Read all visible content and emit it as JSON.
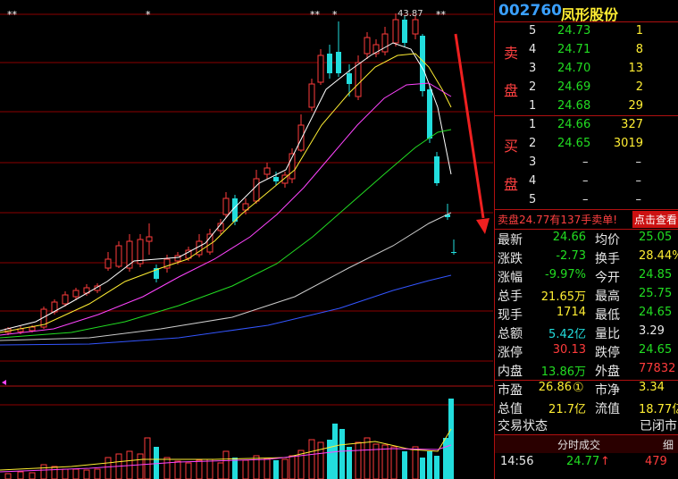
{
  "stock": {
    "code": "002760",
    "name": "凤形股份"
  },
  "marks": {
    "top_value": "43.87"
  },
  "sell_side": [
    "卖",
    "盘"
  ],
  "buy_side": [
    "买",
    "盘"
  ],
  "sell_orders": [
    {
      "level": "5",
      "price": "24.73",
      "volume": "1"
    },
    {
      "level": "4",
      "price": "24.71",
      "volume": "8"
    },
    {
      "level": "3",
      "price": "24.70",
      "volume": "13"
    },
    {
      "level": "2",
      "price": "24.69",
      "volume": "2"
    },
    {
      "level": "1",
      "price": "24.68",
      "volume": "29"
    }
  ],
  "buy_orders": [
    {
      "level": "1",
      "price": "24.66",
      "volume": "327"
    },
    {
      "level": "2",
      "price": "24.65",
      "volume": "3019"
    },
    {
      "level": "3",
      "price": "–",
      "volume": "–"
    },
    {
      "level": "4",
      "price": "–",
      "volume": "–"
    },
    {
      "level": "5",
      "price": "–",
      "volume": "–"
    }
  ],
  "notice": {
    "text": "卖盘24.77有137手卖单!",
    "action": "点击查看"
  },
  "stats": [
    {
      "l1": "最新",
      "v1": "24.66",
      "c1": "green",
      "l2": "均价",
      "v2": "25.05",
      "c2": "green"
    },
    {
      "l1": "涨跌",
      "v1": "-2.73",
      "c1": "green",
      "l2": "换手",
      "v2": "28.44%",
      "c2": "yellow"
    },
    {
      "l1": "涨幅",
      "v1": "-9.97%",
      "c1": "green",
      "l2": "今开",
      "v2": "24.85",
      "c2": "green"
    },
    {
      "l1": "总手",
      "v1": "21.65万",
      "c1": "yellow",
      "l2": "最高",
      "v2": "25.75",
      "c2": "green"
    },
    {
      "l1": "现手",
      "v1": "1714",
      "c1": "yellow",
      "l2": "最低",
      "v2": "24.65",
      "c2": "green"
    },
    {
      "l1": "总额",
      "v1": "5.42亿",
      "c1": "cyan",
      "l2": "量比",
      "v2": "3.29",
      "c2": "white"
    },
    {
      "l1": "涨停",
      "v1": "30.13",
      "c1": "red",
      "l2": "跌停",
      "v2": "24.65",
      "c2": "green"
    },
    {
      "l1": "内盘",
      "v1": "13.86万",
      "c1": "green",
      "l2": "外盘",
      "v2": "77832",
      "c2": "red"
    }
  ],
  "valuation": [
    {
      "l1": "市盈",
      "v1": "26.86",
      "badge": "①",
      "l2": "市净",
      "v2": "3.34"
    },
    {
      "l1": "总值",
      "v1": "21.7亿",
      "badge": "",
      "l2": "流值",
      "v2": "18.77亿"
    }
  ],
  "trade_status": {
    "label": "交易状态",
    "value": "已闭市"
  },
  "ticks": {
    "tab": "分时成交",
    "detail": "细",
    "rows": [
      {
        "time": "14:56",
        "price": "24.77",
        "arrow": "↑",
        "volume": "479"
      }
    ]
  },
  "colors": {
    "up": "#ff3b3b",
    "down": "#22dddd",
    "ma5": "#ffffff",
    "ma10": "#ffee33",
    "ma20": "#ff44ff",
    "ma30": "#22dd22",
    "ma60": "#cccccc",
    "ma120": "#3355ff",
    "grid": "#8b0000"
  }
}
